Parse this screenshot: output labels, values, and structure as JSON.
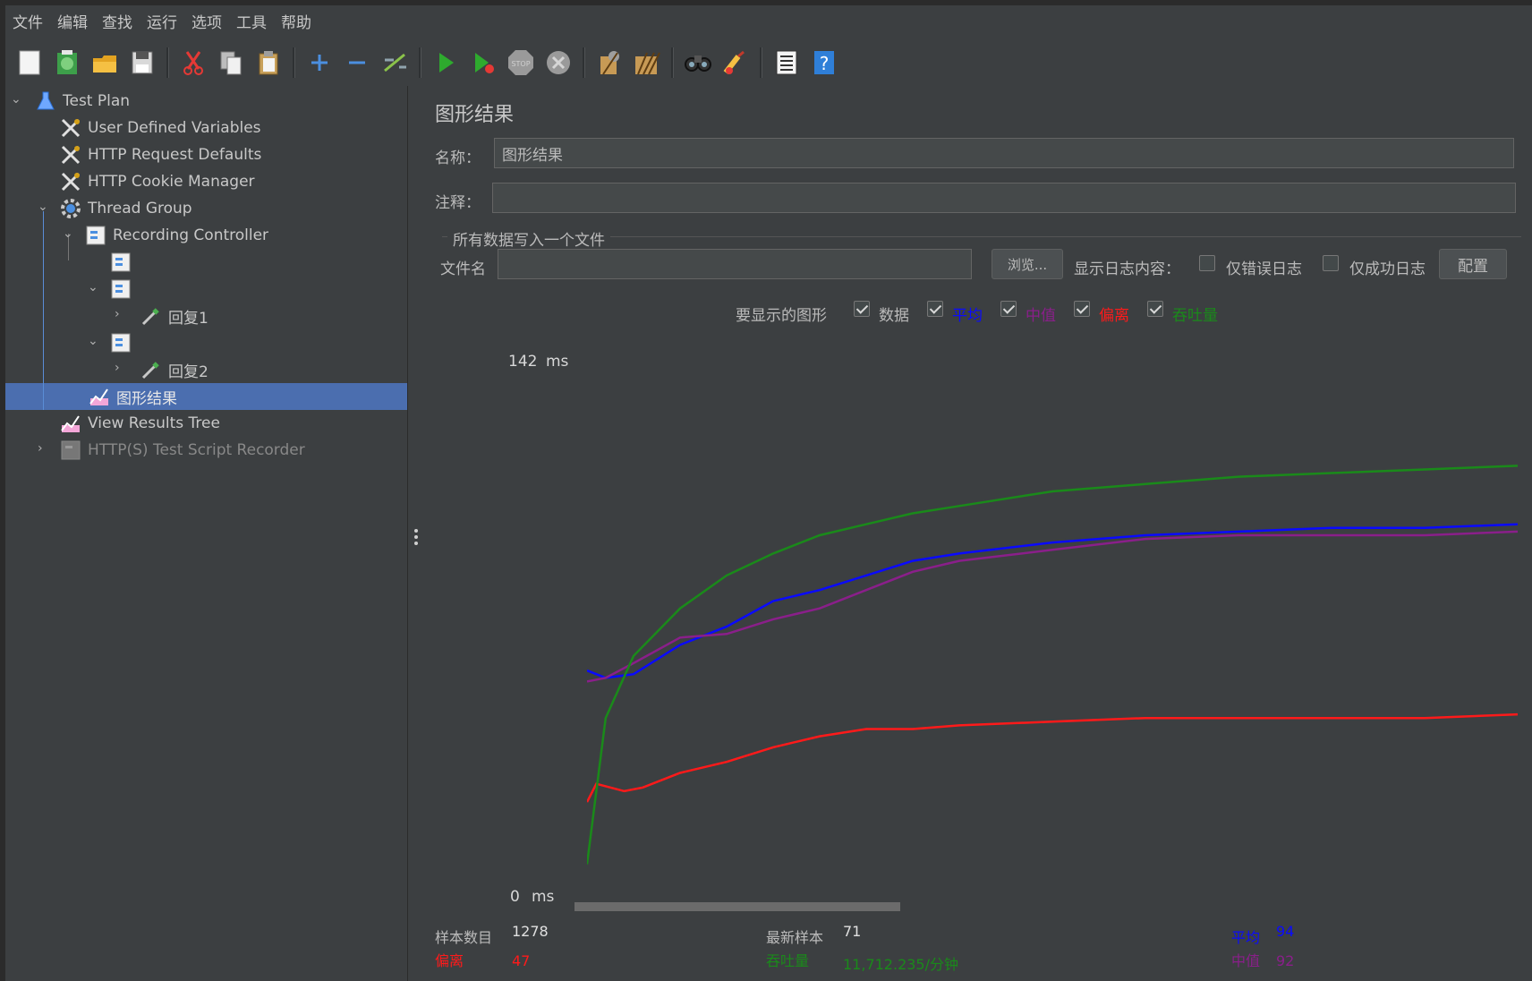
{
  "menu": [
    "文件",
    "编辑",
    "查找",
    "运行",
    "选项",
    "工具",
    "帮助"
  ],
  "toolbar_icons": [
    "new-icon",
    "templates-icon",
    "open-icon",
    "save-icon",
    "cut-icon",
    "copy-icon",
    "paste-icon",
    "expand-icon",
    "collapse-icon",
    "toggle-icon",
    "start-icon",
    "start-no-pauses-icon",
    "stop-icon",
    "shutdown-icon",
    "clear-icon",
    "clear-all-icon",
    "search-icon",
    "reset-search-icon",
    "function-helper-icon",
    "help-icon"
  ],
  "tree": {
    "test_plan": "Test Plan",
    "udv": "User Defined Variables",
    "http_defaults": "HTTP Request Defaults",
    "cookie_manager": "HTTP Cookie Manager",
    "thread_group": "Thread Group",
    "recording_controller": "Recording Controller",
    "reply1": "回复1",
    "reply2": "回复2",
    "graph_results": "图形结果",
    "view_results_tree": "View Results Tree",
    "recorder": "HTTP(S) Test Script Recorder"
  },
  "panel": {
    "title": "图形结果",
    "name_label": "名称：",
    "name_value": "图形结果",
    "comment_label": "注释：",
    "comment_value": "",
    "file_group": "所有数据写入一个文件",
    "filename_label": "文件名",
    "filename_value": "",
    "browse": "浏览...",
    "log_label": "显示日志内容：",
    "errors_only": "仅错误日志",
    "success_only": "仅成功日志",
    "configure": "配置",
    "graphs_label": "要显示的图形",
    "graph_options": [
      "数据",
      "平均",
      "中值",
      "偏离",
      "吞吐量"
    ]
  },
  "chart_data": {
    "type": "line",
    "ymax_label": "142",
    "ymin_label": "0",
    "unit": "ms",
    "ylim": [
      0,
      142
    ],
    "series": [
      {
        "name": "平均",
        "color": "#0a0aff",
        "x": [
          0,
          0.02,
          0.05,
          0.1,
          0.15,
          0.2,
          0.25,
          0.3,
          0.35,
          0.4,
          0.5,
          0.6,
          0.7,
          0.8,
          0.9,
          1.0
        ],
        "values": [
          58,
          56,
          57,
          65,
          70,
          77,
          80,
          84,
          88,
          90,
          93,
          95,
          96,
          97,
          97,
          98
        ]
      },
      {
        "name": "中值",
        "color": "#8a1f8a",
        "x": [
          0,
          0.02,
          0.05,
          0.1,
          0.15,
          0.2,
          0.25,
          0.3,
          0.35,
          0.4,
          0.5,
          0.6,
          0.7,
          0.8,
          0.9,
          1.0
        ],
        "values": [
          55,
          56,
          60,
          67,
          68,
          72,
          75,
          80,
          85,
          88,
          91,
          94,
          95,
          95,
          95,
          96
        ]
      },
      {
        "name": "偏离",
        "color": "#ff1a1a",
        "x": [
          0,
          0.01,
          0.04,
          0.06,
          0.1,
          0.15,
          0.2,
          0.25,
          0.3,
          0.35,
          0.4,
          0.5,
          0.6,
          0.7,
          0.8,
          0.9,
          1.0
        ],
        "values": [
          22,
          27,
          25,
          26,
          30,
          33,
          37,
          40,
          42,
          42,
          43,
          44,
          45,
          45,
          45,
          45,
          46
        ]
      },
      {
        "name": "吞吐量",
        "color": "#1a8a1a",
        "x": [
          0,
          0.02,
          0.05,
          0.1,
          0.15,
          0.2,
          0.25,
          0.3,
          0.35,
          0.4,
          0.5,
          0.6,
          0.7,
          0.8,
          0.9,
          1.0
        ],
        "values": [
          5,
          45,
          62,
          75,
          84,
          90,
          95,
          98,
          101,
          103,
          107,
          109,
          111,
          112,
          113,
          114
        ]
      }
    ]
  },
  "stats": {
    "samples_label": "样本数目",
    "samples_value": "1278",
    "latest_label": "最新样本",
    "latest_value": "71",
    "average_label": "平均",
    "average_value": "94",
    "deviation_label": "偏离",
    "deviation_value": "47",
    "throughput_label": "吞吐量",
    "throughput_value": "11,712.235/分钟",
    "median_label": "中值",
    "median_value": "92"
  },
  "colors": {
    "selection": "#4b6eaf",
    "background": "#3c3f41",
    "average": "#0a0aff",
    "median": "#8a1f8a",
    "deviation": "#ff1a1a",
    "throughput": "#1a8a1a"
  }
}
